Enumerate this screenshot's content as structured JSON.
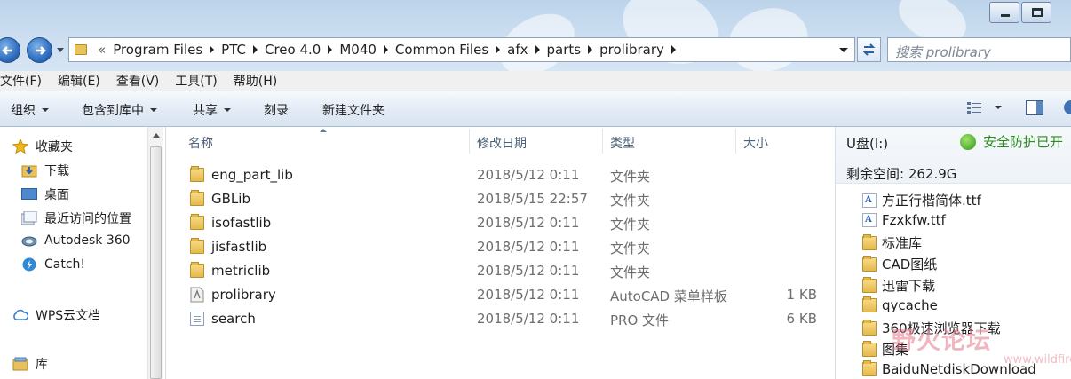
{
  "address": {
    "overflow": "«",
    "crumbs": [
      "Program Files",
      "PTC",
      "Creo 4.0",
      "M040",
      "Common Files",
      "afx",
      "parts",
      "prolibrary"
    ],
    "search_placeholder": "搜索 prolibrary"
  },
  "menu": [
    "文件(F)",
    "编辑(E)",
    "查看(V)",
    "工具(T)",
    "帮助(H)"
  ],
  "toolbar": {
    "organize": "组织",
    "include_in_library": "包含到库中",
    "share": "共享",
    "burn": "刻录",
    "new_folder": "新建文件夹"
  },
  "nav": {
    "favorites": "收藏夹",
    "downloads": "下载",
    "desktop": "桌面",
    "recent": "最近访问的位置",
    "autodesk": "Autodesk 360",
    "catch": "Catch!",
    "wps": "WPS云文档",
    "libraries": "库"
  },
  "columns": {
    "name": "名称",
    "date": "修改日期",
    "type": "类型",
    "size": "大小"
  },
  "files": [
    {
      "name": "eng_part_lib",
      "date": "2018/5/12 0:11",
      "type": "文件夹",
      "size": "",
      "icon": "folder-icon"
    },
    {
      "name": "GBLib",
      "date": "2018/5/15 22:57",
      "type": "文件夹",
      "size": "",
      "icon": "folder-icon"
    },
    {
      "name": "isofastlib",
      "date": "2018/5/12 0:11",
      "type": "文件夹",
      "size": "",
      "icon": "folder-icon"
    },
    {
      "name": "jisfastlib",
      "date": "2018/5/12 0:11",
      "type": "文件夹",
      "size": "",
      "icon": "folder-icon"
    },
    {
      "name": "metriclib",
      "date": "2018/5/12 0:11",
      "type": "文件夹",
      "size": "",
      "icon": "folder-icon"
    },
    {
      "name": "prolibrary",
      "date": "2018/5/12 0:11",
      "type": "AutoCAD 菜单样板",
      "size": "1 KB",
      "icon": "autocad-file-icon"
    },
    {
      "name": "search",
      "date": "2018/5/12 0:11",
      "type": "PRO 文件",
      "size": "6 KB",
      "icon": "document-icon"
    }
  ],
  "right_pane": {
    "drive": "U盘(I:)",
    "safety": "安全防护已开",
    "free_space": "剩余空间: 262.9G",
    "items": [
      {
        "label": "方正行楷简体.ttf",
        "icon": "font-file-icon"
      },
      {
        "label": "Fzxkfw.ttf",
        "icon": "font-file-icon"
      },
      {
        "label": "标准库",
        "icon": "folder-icon"
      },
      {
        "label": "CAD图纸",
        "icon": "folder-icon"
      },
      {
        "label": "迅雷下载",
        "icon": "folder-icon"
      },
      {
        "label": "qycache",
        "icon": "folder-icon"
      },
      {
        "label": "360极速浏览器下载",
        "icon": "folder-icon"
      },
      {
        "label": "图集",
        "icon": "folder-icon"
      },
      {
        "label": "BaiduNetdiskDownload",
        "icon": "folder-icon"
      }
    ]
  },
  "watermark": {
    "text": "野火论坛",
    "url": "www.wildfire.cn"
  }
}
